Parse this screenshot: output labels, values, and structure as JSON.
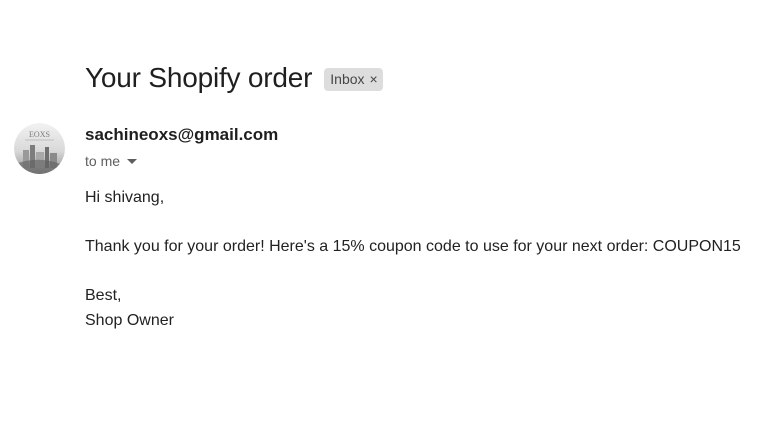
{
  "email": {
    "subject": "Your Shopify order",
    "label": {
      "text": "Inbox",
      "remove_glyph": "×"
    },
    "sender": {
      "email": "sachineoxs@gmail.com",
      "avatar_icon": "sender-avatar-eoxs-logo",
      "avatar_text": "EOXS"
    },
    "recipient_text": "to me",
    "body": {
      "greeting": "Hi shivang,",
      "message": "Thank you for your order! Here's a 15% coupon code to use for your next order: COUPON15",
      "signoff": "Best,",
      "signature": "Shop Owner"
    }
  }
}
